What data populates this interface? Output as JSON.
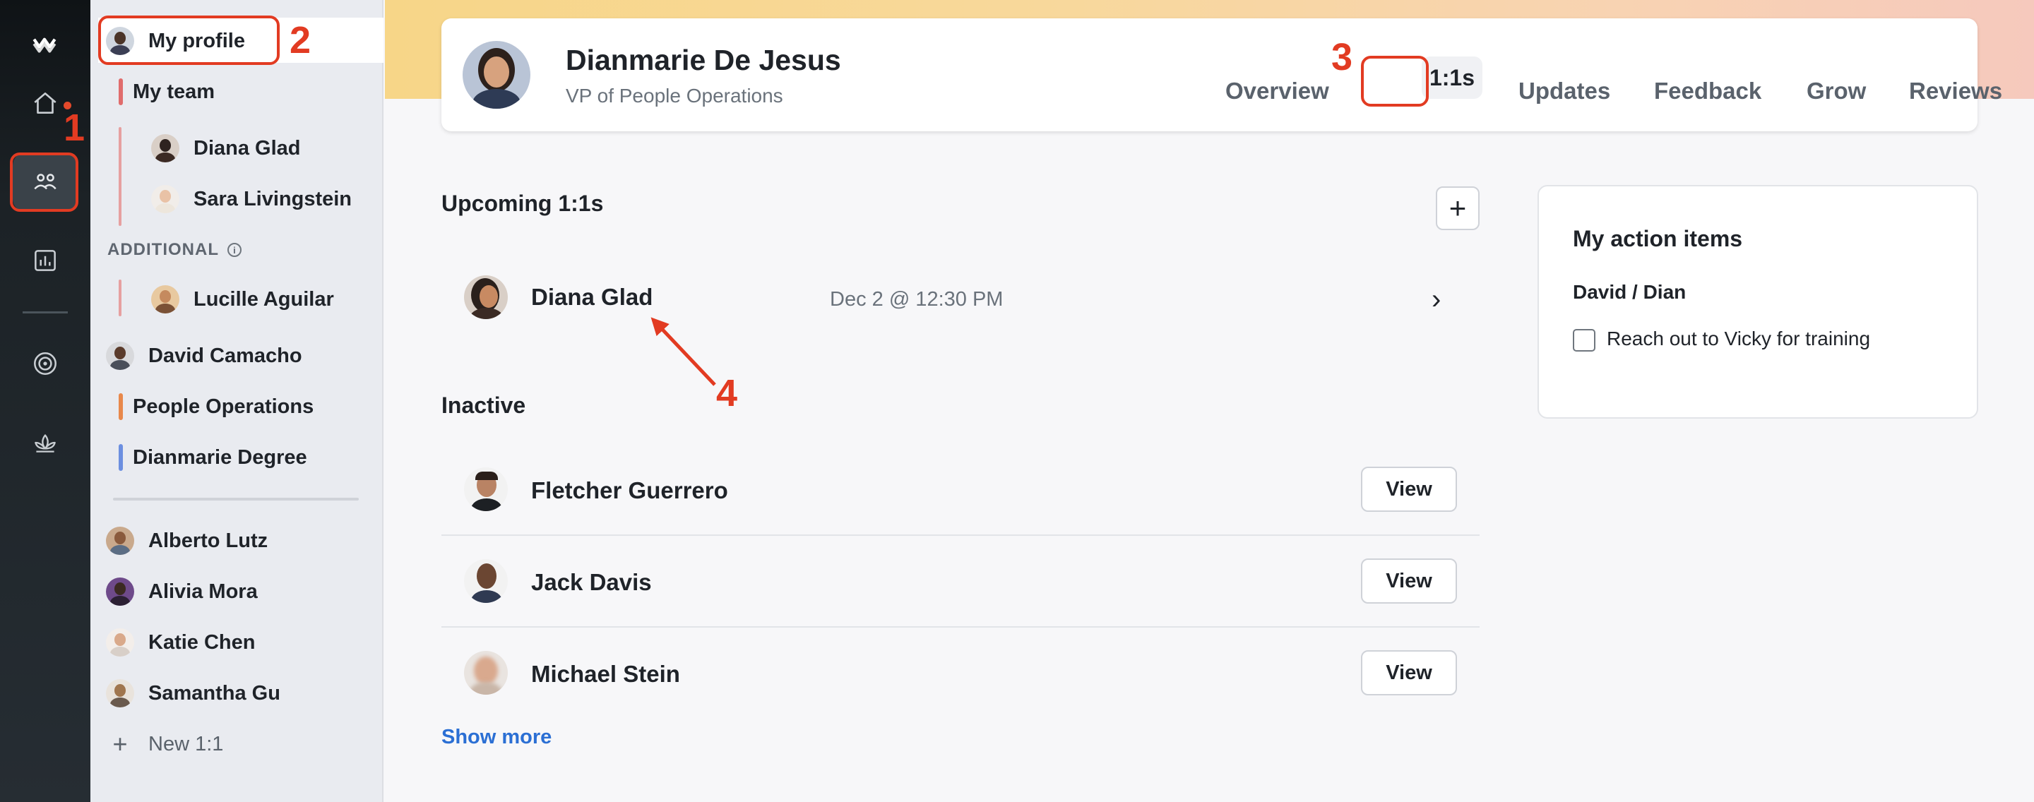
{
  "rail": {
    "icons": [
      "logo-icon",
      "home-icon",
      "people-icon",
      "chart-icon",
      "target-icon",
      "lotus-icon"
    ]
  },
  "sidebar": {
    "my_profile": "My profile",
    "my_team": "My team",
    "team_members": [
      "Diana Glad",
      "Sara Livingstein"
    ],
    "additional_label": "ADDITIONAL",
    "additional_members": [
      "Lucille Aguilar"
    ],
    "groups": [
      {
        "label": "David Camacho",
        "type": "person"
      },
      {
        "label": "People Operations",
        "color": "#e8884b"
      },
      {
        "label": "Dianmarie Degree",
        "color": "#6c8fe0"
      }
    ],
    "people": [
      "Alberto Lutz",
      "Alivia Mora",
      "Katie Chen",
      "Samantha Gu"
    ],
    "new_11": "New 1:1",
    "my_team_color": "#e06c6c"
  },
  "profile": {
    "name": "Dianmarie De Jesus",
    "title": "VP of People Operations"
  },
  "tabs": [
    "Overview",
    "1:1s",
    "Updates",
    "Feedback",
    "Grow",
    "Reviews"
  ],
  "active_tab": "1:1s",
  "upcoming": {
    "title": "Upcoming 1:1s",
    "items": [
      {
        "name": "Diana Glad",
        "date": "Dec 2 @ 12:30 PM"
      }
    ]
  },
  "inactive": {
    "title": "Inactive",
    "items": [
      {
        "name": "Fletcher Guerrero",
        "action": "View"
      },
      {
        "name": "Jack Davis",
        "action": "View"
      },
      {
        "name": "Michael Stein",
        "action": "View"
      }
    ],
    "show_more": "Show more"
  },
  "action_items": {
    "title": "My action items",
    "group": "David / Dian",
    "items": [
      {
        "text": "Reach out to Vicky for training",
        "checked": false
      }
    ]
  },
  "annotations": [
    "1",
    "2",
    "3",
    "4"
  ],
  "colors": {
    "annotation": "#e23b22",
    "link": "#2b6fd4",
    "rail": "#262d33"
  }
}
